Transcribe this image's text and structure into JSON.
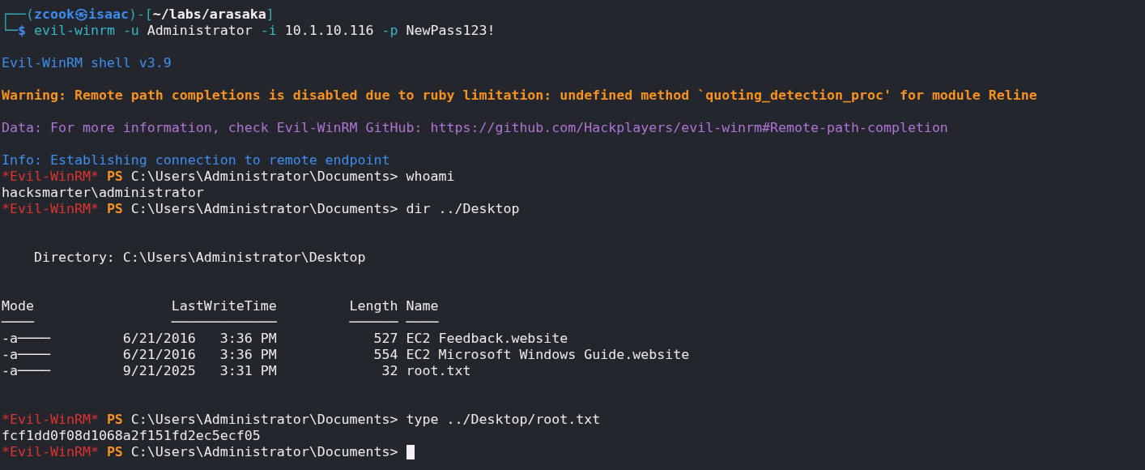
{
  "terminal": {
    "lines": [
      {
        "kind": "text",
        "segments": [
          {
            "text": "┌──(",
            "kind": "frame"
          },
          {
            "text": "zcook㉿isaac",
            "kind": "user"
          },
          {
            "text": ")-[",
            "kind": "frame"
          },
          {
            "text": "~/labs/arasaka",
            "kind": "path"
          },
          {
            "text": "]",
            "kind": "frame"
          }
        ]
      },
      {
        "kind": "text",
        "segments": [
          {
            "text": "└─",
            "kind": "frame"
          },
          {
            "text": "$ ",
            "kind": "user"
          },
          {
            "text": "evil-winrm ",
            "kind": "command"
          },
          {
            "text": "-u ",
            "kind": "flag"
          },
          {
            "text": "Administrator ",
            "kind": "plain"
          },
          {
            "text": "-i ",
            "kind": "flag"
          },
          {
            "text": "10.1.10.116 ",
            "kind": "plain"
          },
          {
            "text": "-p ",
            "kind": "flag"
          },
          {
            "text": "NewPass123!",
            "kind": "plain"
          }
        ]
      },
      {
        "kind": "blank"
      },
      {
        "kind": "text",
        "segments": [
          {
            "text": "Evil-WinRM shell v3.9",
            "kind": "info"
          }
        ]
      },
      {
        "kind": "blank"
      },
      {
        "kind": "text",
        "segments": [
          {
            "text": "Warning: Remote path completions is disabled due to ruby limitation: undefined method `quoting_detection_proc' for module Reline",
            "kind": "warning"
          }
        ]
      },
      {
        "kind": "blank"
      },
      {
        "kind": "text",
        "segments": [
          {
            "text": "Data: For more information, check Evil-WinRM GitHub: https://github.com/Hackplayers/evil-winrm#Remote-path-completion",
            "kind": "data"
          }
        ]
      },
      {
        "kind": "blank"
      },
      {
        "kind": "text",
        "segments": [
          {
            "text": "Info: Establishing connection to remote endpoint",
            "kind": "info"
          }
        ]
      },
      {
        "kind": "text",
        "segments": [
          {
            "text": "*Evil-WinRM*",
            "kind": "shell"
          },
          {
            "text": " PS",
            "kind": "ps"
          },
          {
            "text": " C:\\Users\\Administrator\\Documents> whoami",
            "kind": "plain"
          }
        ]
      },
      {
        "kind": "text",
        "segments": [
          {
            "text": "hacksmarter\\administrator",
            "kind": "plain"
          }
        ]
      },
      {
        "kind": "text",
        "segments": [
          {
            "text": "*Evil-WinRM*",
            "kind": "shell"
          },
          {
            "text": " PS",
            "kind": "ps"
          },
          {
            "text": " C:\\Users\\Administrator\\Documents> dir ../Desktop",
            "kind": "plain"
          }
        ]
      },
      {
        "kind": "blank"
      },
      {
        "kind": "blank"
      },
      {
        "kind": "text",
        "segments": [
          {
            "text": "    Directory: C:\\Users\\Administrator\\Desktop",
            "kind": "plain"
          }
        ]
      },
      {
        "kind": "blank"
      },
      {
        "kind": "blank"
      },
      {
        "kind": "text",
        "segments": [
          {
            "text": "Mode                 LastWriteTime         Length Name",
            "kind": "plain"
          }
        ]
      },
      {
        "kind": "text",
        "segments": [
          {
            "text": "────                 ─────────────         ────── ────",
            "kind": "plain"
          }
        ]
      },
      {
        "kind": "text",
        "segments": [
          {
            "text": "-a────         6/21/2016   3:36 PM            527 EC2 Feedback.website",
            "kind": "plain"
          }
        ]
      },
      {
        "kind": "text",
        "segments": [
          {
            "text": "-a────         6/21/2016   3:36 PM            554 EC2 Microsoft Windows Guide.website",
            "kind": "plain"
          }
        ]
      },
      {
        "kind": "text",
        "segments": [
          {
            "text": "-a────         9/21/2025   3:31 PM             32 root.txt",
            "kind": "plain"
          }
        ]
      },
      {
        "kind": "blank"
      },
      {
        "kind": "blank"
      },
      {
        "kind": "text",
        "segments": [
          {
            "text": "*Evil-WinRM*",
            "kind": "shell"
          },
          {
            "text": " PS",
            "kind": "ps"
          },
          {
            "text": " C:\\Users\\Administrator\\Documents> type ../Desktop/root.txt",
            "kind": "plain"
          }
        ]
      },
      {
        "kind": "text",
        "segments": [
          {
            "text": "fcf1dd0f08d1068a2f151fd2ec5ecf05",
            "kind": "plain"
          }
        ]
      },
      {
        "kind": "active",
        "segments": [
          {
            "text": "*Evil-WinRM*",
            "kind": "shell"
          },
          {
            "text": " PS",
            "kind": "ps"
          },
          {
            "text": " C:\\Users\\Administrator\\Documents> ",
            "kind": "plain"
          }
        ]
      }
    ]
  }
}
